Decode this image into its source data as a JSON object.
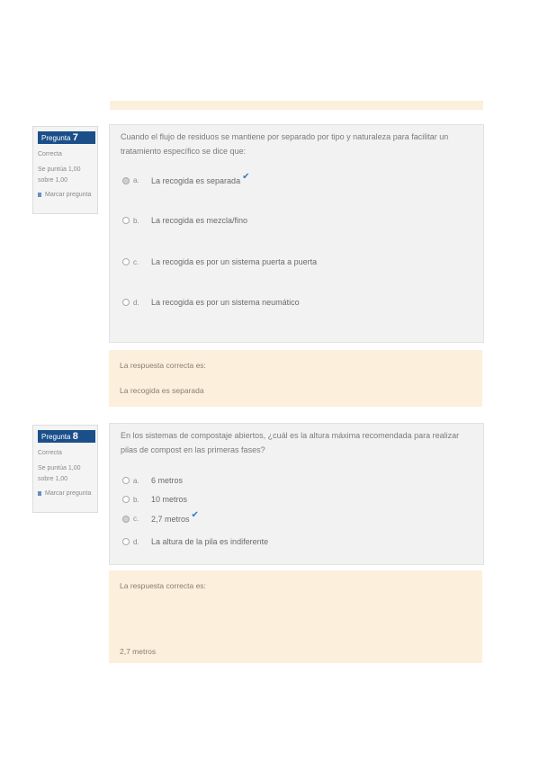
{
  "questions": [
    {
      "label_prefix": "Pregunta",
      "number": "7",
      "status": "Correcta",
      "score_line1": "Se puntúa 1,00",
      "score_line2": "sobre 1,00",
      "flag_label": "Marcar pregunta",
      "text": "Cuando el flujo de residuos se mantiene por separado por tipo y naturaleza para facilitar un tratamiento específico se dice que:",
      "options": [
        {
          "letter": "a.",
          "text": "La recogida es separada",
          "selected": true,
          "correct": true
        },
        {
          "letter": "b.",
          "text": "La recogida es mezcla/fino",
          "selected": false,
          "correct": false
        },
        {
          "letter": "c.",
          "text": "La recogida es por un sistema puerta a puerta",
          "selected": false,
          "correct": false
        },
        {
          "letter": "d.",
          "text": "La recogida es por un sistema neumático",
          "selected": false,
          "correct": false
        }
      ],
      "feedback_title": "La respuesta correcta es:",
      "feedback_answer": "La recogida es separada"
    },
    {
      "label_prefix": "Pregunta",
      "number": "8",
      "status": "Correcta",
      "score_line1": "Se puntúa 1,00",
      "score_line2": "sobre 1,00",
      "flag_label": "Marcar pregunta",
      "text": "En los sistemas de compostaje abiertos, ¿cuál es la altura máxima recomendada para realizar pilas de compost en las primeras fases?",
      "options": [
        {
          "letter": "a.",
          "text": "6 metros",
          "selected": false,
          "correct": false
        },
        {
          "letter": "b.",
          "text": "10 metros",
          "selected": false,
          "correct": false
        },
        {
          "letter": "c.",
          "text": "2,7 metros",
          "selected": true,
          "correct": true
        },
        {
          "letter": "d.",
          "text": "La altura de la pila es indiferente",
          "selected": false,
          "correct": false
        }
      ],
      "feedback_title": "La respuesta correcta es:",
      "feedback_answer": "2,7 metros"
    }
  ],
  "icons": {
    "check": "checkmark-icon",
    "flag": "flag-icon",
    "radio": "radio-icon"
  },
  "colors": {
    "question_badge": "#1b4f8a",
    "feedback_bg": "#fcefdc",
    "check": "#2a7fc9"
  }
}
